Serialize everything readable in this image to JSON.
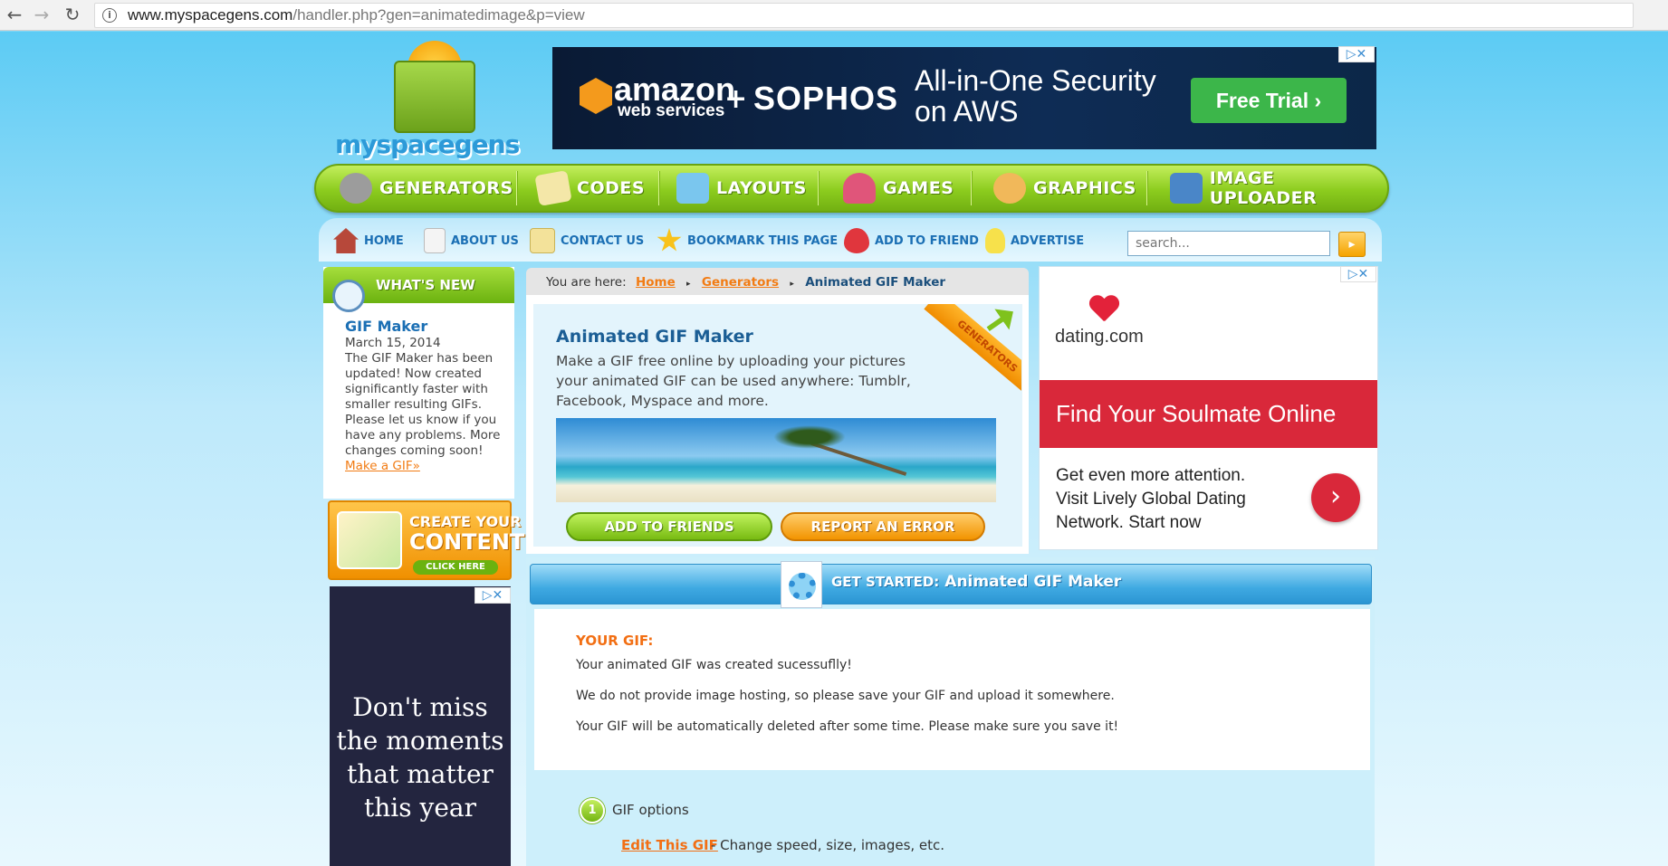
{
  "browser": {
    "back_icon": "←",
    "forward_icon": "→",
    "reload_icon": "↻",
    "url_host": "www.myspacegens.com",
    "url_path": "/handler.php?gen=animatedimage&p=view"
  },
  "logo": {
    "text": "myspacegens"
  },
  "top_ad": {
    "brand1": "amazon",
    "brand1_sub": "web services",
    "plus": "+",
    "brand2": "SOPHOS",
    "headline_line1": "All-in-One Security",
    "headline_line2": "on AWS",
    "cta": "Free Trial ›",
    "adchoices": "▷✕"
  },
  "main_menu": [
    {
      "label": "GENERATORS",
      "icon": "gear-icon",
      "color": "#9c9c9c"
    },
    {
      "label": "CODES",
      "icon": "notepad-icon",
      "color": "#f4e7a8"
    },
    {
      "label": "LAYOUTS",
      "icon": "layout-chart-icon",
      "color": "#7ac6ee"
    },
    {
      "label": "GAMES",
      "icon": "joystick-icon",
      "color": "#e0557a"
    },
    {
      "label": "GRAPHICS",
      "icon": "palette-icon",
      "color": "#f1b85a"
    },
    {
      "label": "IMAGE UPLOADER",
      "icon": "upload-image-icon",
      "color": "#4a86c8"
    }
  ],
  "sub_nav": [
    {
      "label": "HOME",
      "icon": "home-icon",
      "color": "#b7483a"
    },
    {
      "label": "ABOUT US",
      "icon": "document-icon",
      "color": "#f4f4f4"
    },
    {
      "label": "CONTACT US",
      "icon": "pencil-note-icon",
      "color": "#f3e29a"
    },
    {
      "label": "BOOKMARK THIS PAGE",
      "icon": "star-plus-icon",
      "color": "#f8c21b"
    },
    {
      "label": "ADD TO FRIEND",
      "icon": "heart-plus-icon",
      "color": "#e0363d"
    },
    {
      "label": "ADVERTISE",
      "icon": "lightbulb-icon",
      "color": "#f7e14b"
    }
  ],
  "search": {
    "placeholder": "search...",
    "button_icon": "▸"
  },
  "whats_new": {
    "header": "WHAT'S NEW",
    "item_title": "GIF Maker",
    "item_date": "March 15, 2014",
    "item_text": "The GIF Maker has been updated! Now created significantly faster with smaller resulting GIFs. Please let us know if you have any problems. More changes coming soon!",
    "item_link": "Make a GIF»"
  },
  "create_content": {
    "line1": "CREATE YOUR",
    "line2": "CONTENT",
    "button": "CLICK HERE"
  },
  "left_ad": {
    "message": "Don't miss the moments that matter this year",
    "adchoices": "▷✕"
  },
  "breadcrumb": {
    "prefix": "You are here:",
    "home": "Home",
    "generators": "Generators",
    "current": "Animated GIF Maker",
    "separator": "▸"
  },
  "intro": {
    "title": "Animated GIF Maker",
    "description": "Make a GIF free online by uploading your pictures your animated GIF can be used anywhere: Tumblr, Facebook, Myspace and more.",
    "corner_tag": "GENERATORS",
    "add_friends_button": "ADD TO FRIENDS",
    "report_error_button": "REPORT AN ERROR"
  },
  "right_ad": {
    "brand": "dating.com",
    "band": "Find Your Soulmate Online",
    "body": "Get even more attention. Visit Lively Global Dating Network. Start now",
    "go_icon": "›",
    "adchoices": "▷✕"
  },
  "get_started": {
    "label": "GET STARTED:",
    "title": "Animated GIF Maker",
    "result_label": "YOUR GIF:",
    "line1": "Your animated GIF was created sucessuflly!",
    "line2": "We do not provide image hosting, so please save your GIF and upload it somewhere.",
    "line3": "Your GIF will be automatically deleted after some time. Please make sure you save it!",
    "step_number": "1",
    "step_label": "GIF options",
    "edit_link": "Edit This GIF",
    "edit_desc": "- Change speed, size, images, etc."
  },
  "colors": {
    "accent_green": "#8ccc1e",
    "accent_orange": "#f27c14",
    "link_blue": "#1b6fb4",
    "ad_red": "#d9283a"
  }
}
